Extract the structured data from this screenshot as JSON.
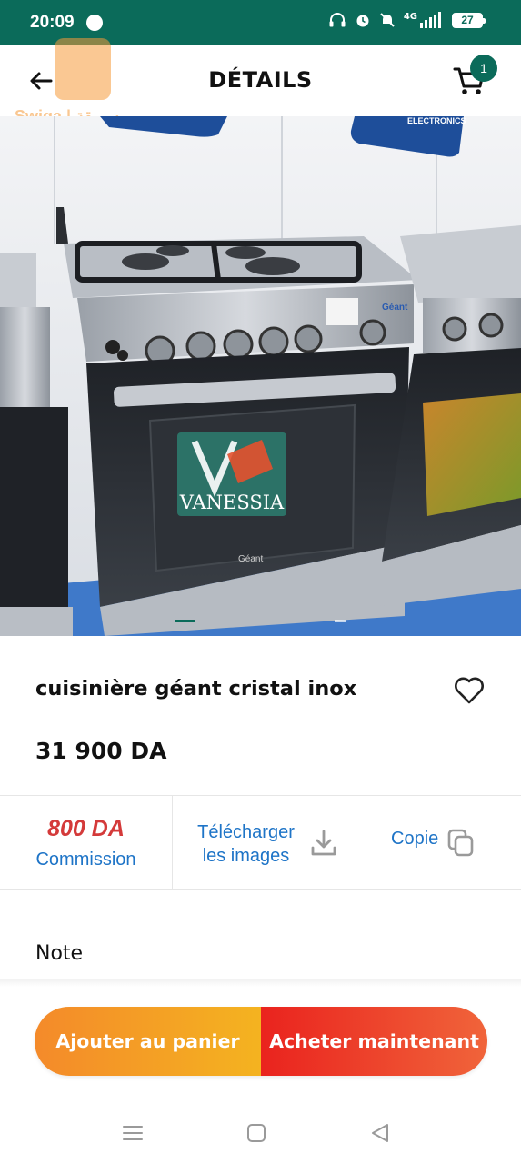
{
  "status_bar": {
    "time": "20:09",
    "battery": "27",
    "network": "4G"
  },
  "header": {
    "title": "DÉTAILS",
    "cart_count": "1",
    "logo_text": "Swiga | سويقة"
  },
  "gallery": {
    "watermark_text": "VANESSIA",
    "brand_text": "Géant",
    "banner_text": "ELECTRONICS",
    "slide_count": 2,
    "active_slide": 1
  },
  "product": {
    "name": "cuisinière géant cristal inox",
    "price": "31 900 DA"
  },
  "actions": {
    "commission_value": "800 DA",
    "commission_label": "Commission",
    "download_label": "Télécharger les images",
    "copy_label": "Copie"
  },
  "note": {
    "label": "Note"
  },
  "cta": {
    "add_to_cart": "Ajouter au panier",
    "buy_now": "Acheter maintenant"
  },
  "colors": {
    "primary": "#0b6b5a",
    "commission_red": "#d43a3a",
    "link_blue": "#1e74c7",
    "orange": "#f48a2a",
    "red": "#ea231e"
  },
  "icons": {
    "back": "arrow-left-icon",
    "cart": "cart-icon",
    "favorite": "heart-outline-icon",
    "download": "download-icon",
    "copy": "copy-icon",
    "nav_menu": "menu-icon",
    "nav_home": "square-icon",
    "nav_back": "triangle-back-icon"
  }
}
